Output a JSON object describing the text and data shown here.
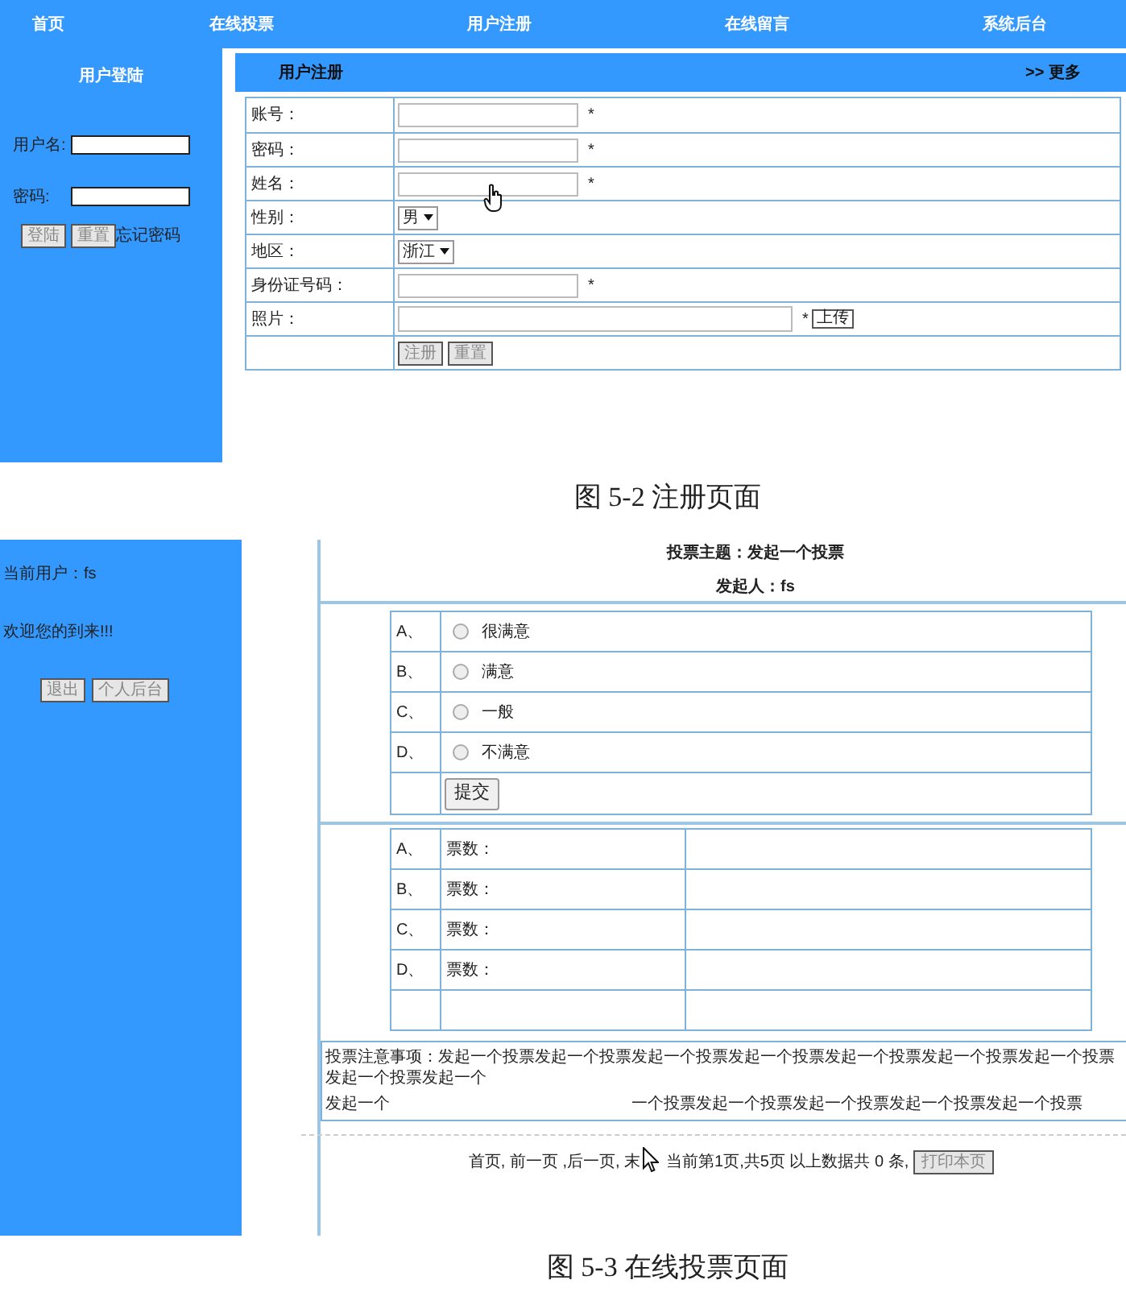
{
  "registration_screenshot": {
    "nav": [
      "首页",
      "在线投票",
      "用户注册",
      "在线留言",
      "系统后台"
    ],
    "login_panel": {
      "title": "用户登陆",
      "username_label": "用户名:",
      "password_label": "密码:",
      "buttons": [
        "登陆",
        "重置"
      ],
      "forgot_link": "忘记密码"
    },
    "form_header": {
      "title": "用户注册",
      "more_link": ">> 更多"
    },
    "form_rows": [
      {
        "kind": "text",
        "label": "账号：",
        "marker": "*"
      },
      {
        "kind": "text",
        "label": "密码：",
        "marker": "*"
      },
      {
        "kind": "text",
        "label": "姓名：",
        "marker": "*"
      },
      {
        "kind": "select",
        "label": "性别：",
        "value": "男"
      },
      {
        "kind": "select",
        "label": "地区：",
        "value": "浙江"
      },
      {
        "kind": "text",
        "label": "身份证号码：",
        "marker": "*"
      },
      {
        "kind": "file",
        "label": "照片：",
        "marker": "*",
        "button": "上传"
      },
      {
        "kind": "buttons",
        "buttons": [
          "注册",
          "重置"
        ]
      }
    ]
  },
  "caption_1": "图 5-2 注册页面",
  "vote_screenshot": {
    "sidebar": {
      "current_user": "当前用户：fs",
      "welcome": "欢迎您的到来!!!",
      "buttons": [
        "退出",
        "个人后台"
      ]
    },
    "title": "投票主题：发起一个投票",
    "initiator": "发起人：fs",
    "options": [
      {
        "letter": "A、",
        "label": "很满意",
        "selected": false
      },
      {
        "letter": "B、",
        "label": "满意",
        "selected": false
      },
      {
        "letter": "C、",
        "label": "一般",
        "selected": false
      },
      {
        "letter": "D、",
        "label": "不满意",
        "selected": false
      }
    ],
    "submit": "提交",
    "results": [
      {
        "letter": "A、",
        "label": "票数："
      },
      {
        "letter": "B、",
        "label": "票数："
      },
      {
        "letter": "C、",
        "label": "票数："
      },
      {
        "letter": "D、",
        "label": "票数："
      }
    ],
    "note_line_1": "投票注意事项：发起一个投票发起一个投票发起一个投票发起一个投票发起一个投票发起一个投票发起一个投票发起一个投票发起一个",
    "note_line_2_start": "发起一个",
    "note_line_2_end": "一个投票发起一个投票发起一个投票发起一个投票发起一个投票",
    "pagination_start": "首页, 前一页 ,后一页, 末",
    "pagination_end": "当前第1页,共5页 以上数据共 0 条,",
    "print_button": "打印本页"
  },
  "caption_2": "图 5-3 在线投票页面"
}
